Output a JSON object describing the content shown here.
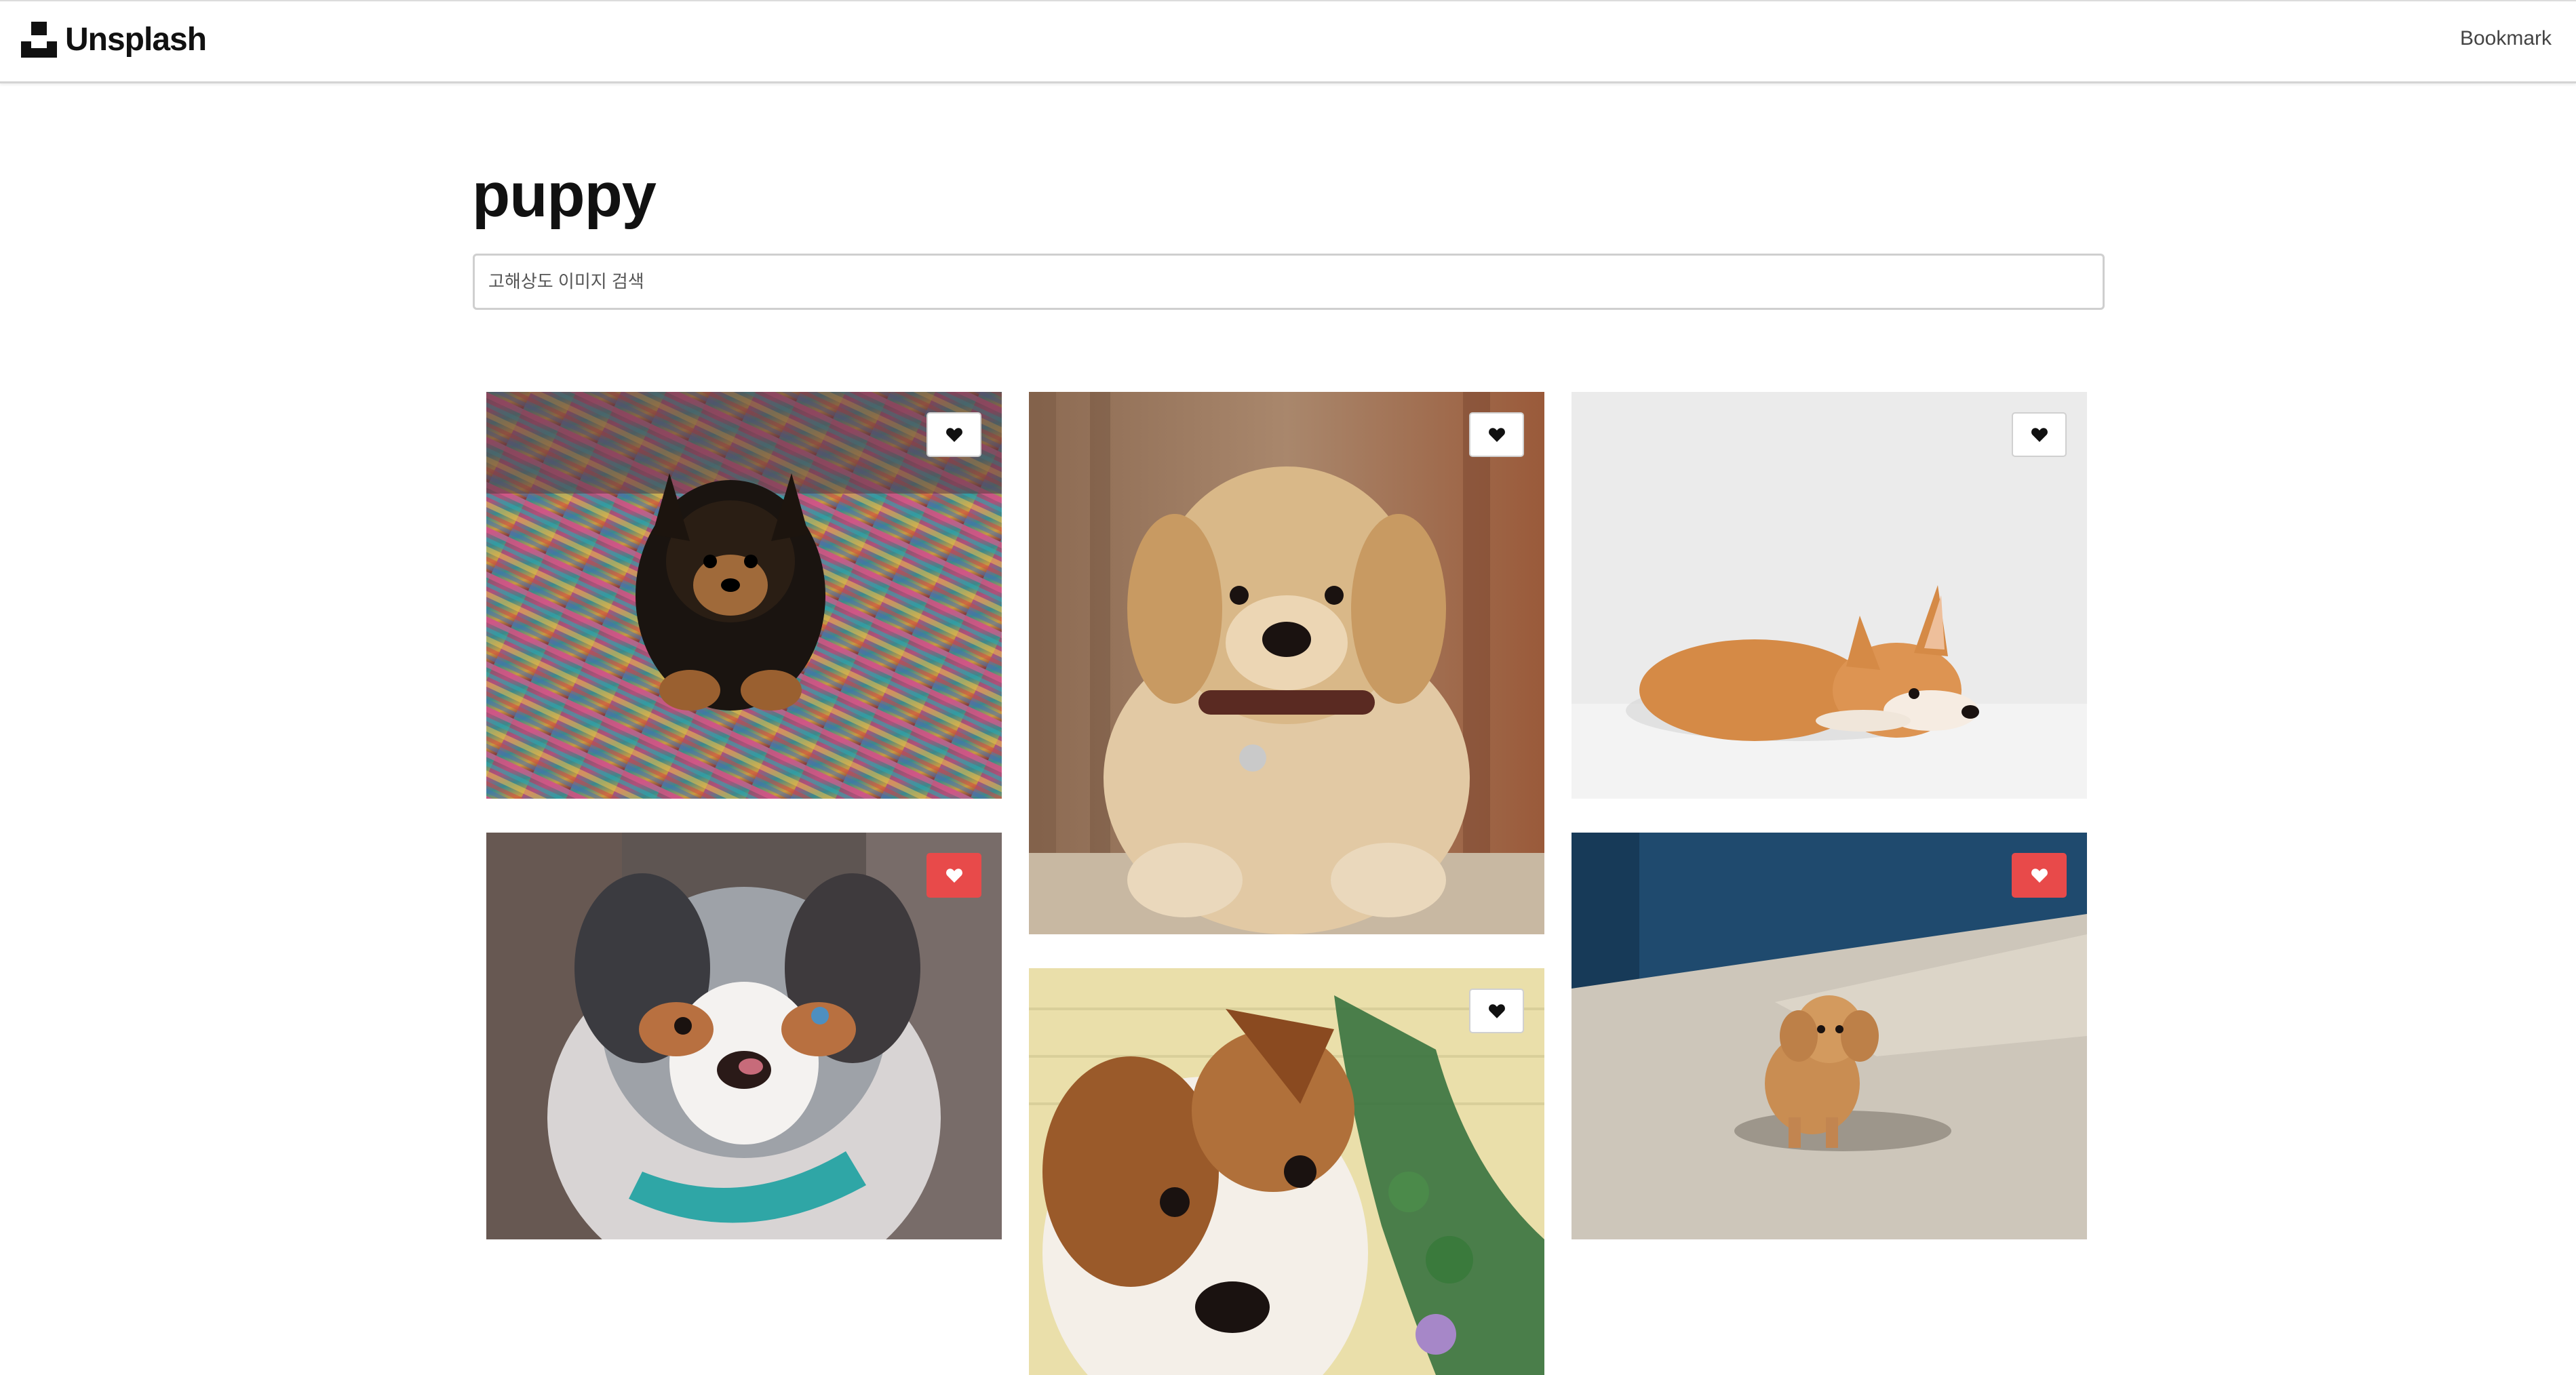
{
  "header": {
    "brand": "Unsplash",
    "bookmark_label": "Bookmark"
  },
  "search": {
    "query_title": "puppy",
    "placeholder": "고해상도 이미지 검색"
  },
  "colors": {
    "liked": "#e84a4a",
    "unliked": "#ffffff"
  },
  "photos": [
    {
      "subject": "yorkshire terrier puppy on striped rug",
      "liked": false
    },
    {
      "subject": "golden retriever puppy with collar",
      "liked": false
    },
    {
      "subject": "corgi lying on white background",
      "liked": false
    },
    {
      "subject": "australian shepherd puppy",
      "liked": true
    },
    {
      "subject": "jack russell puppy close-up",
      "liked": false
    },
    {
      "subject": "toy poodle puppy on concrete",
      "liked": true
    }
  ]
}
